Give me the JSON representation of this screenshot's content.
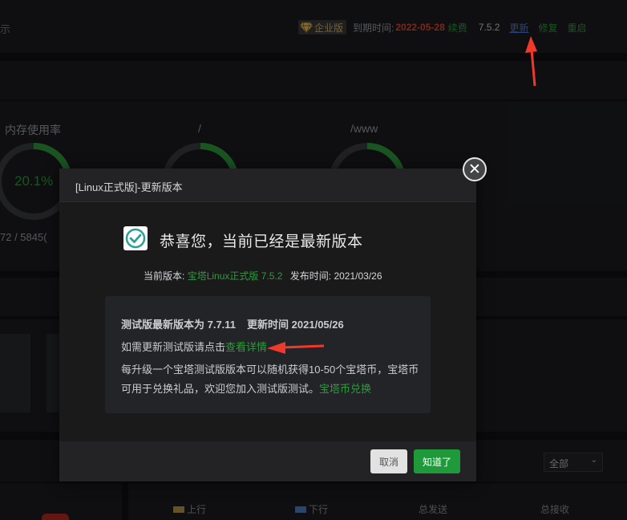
{
  "header": {
    "left_fragment": "示",
    "edition_badge": "企业版",
    "expire_label": "到期时间:",
    "expire_date": "2022-05-28",
    "renew_label": "续费",
    "version": "7.5.2",
    "update_label": "更新",
    "repair_label": "修复",
    "restart_label": "重启"
  },
  "status": {
    "gauges": [
      {
        "title": "内存使用率",
        "value": "20.1%",
        "sub": "72 / 5845(",
        "percent": 20.1
      },
      {
        "title": "/",
        "percent": 28
      },
      {
        "title": "/www",
        "percent": 22
      }
    ]
  },
  "traffic": {
    "select_value": "全部",
    "legend": [
      "上行",
      "下行",
      "总发送",
      "总接收"
    ],
    "upload_color": "#b9954a",
    "download_color": "#4c7fc4"
  },
  "modal": {
    "title": "[Linux正式版]-更新版本",
    "success_title": "恭喜您，当前已经是最新版本",
    "current_version_label": "当前版本:",
    "current_version_value": "宝塔Linux正式版 7.5.2",
    "release_time_label": "发布时间:",
    "release_time_value": "2021/03/26",
    "beta_version_text": "测试版最新版本为 7.7.11",
    "beta_update_time_text": "更新时间  2021/05/26",
    "beta_update_prefix": "如需更新测试版请点击",
    "beta_update_link": "查看详情",
    "beta_desc": "每升级一个宝塔测试版版本可以随机获得10-50个宝塔币，宝塔币可用于兑换礼品，欢迎您加入测试版测试。",
    "coin_exchange_link": "宝塔币兑换",
    "cancel_label": "取消",
    "ok_label": "知道了"
  },
  "colors": {
    "accent_green": "#2e9a3d",
    "date_red": "#e0492c",
    "link_blue": "#4c7fd9",
    "arrow_red": "#f0392b"
  }
}
